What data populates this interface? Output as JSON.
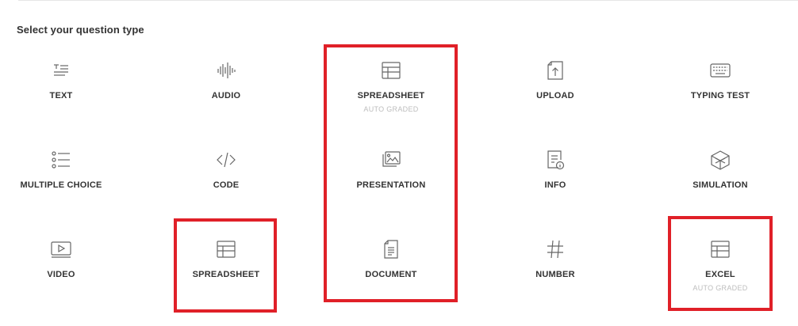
{
  "heading": "Select your question type",
  "tiles": {
    "text": {
      "label": "TEXT",
      "icon": "text-lines-icon"
    },
    "audio": {
      "label": "AUDIO",
      "icon": "waveform-icon"
    },
    "spreadsheet_auto": {
      "label": "SPREADSHEET",
      "sub": "AUTO GRADED",
      "icon": "spreadsheet-icon"
    },
    "upload": {
      "label": "UPLOAD",
      "icon": "file-upload-icon"
    },
    "typing_test": {
      "label": "TYPING TEST",
      "icon": "keyboard-icon"
    },
    "multiple_choice": {
      "label": "MULTIPLE CHOICE",
      "icon": "list-bullets-icon"
    },
    "code": {
      "label": "CODE",
      "icon": "code-brackets-icon"
    },
    "presentation": {
      "label": "PRESENTATION",
      "icon": "presentation-images-icon"
    },
    "info": {
      "label": "INFO",
      "icon": "info-document-icon"
    },
    "simulation": {
      "label": "SIMULATION",
      "icon": "cube-icon"
    },
    "video": {
      "label": "VIDEO",
      "icon": "video-player-icon"
    },
    "spreadsheet": {
      "label": "SPREADSHEET",
      "icon": "spreadsheet-icon"
    },
    "document": {
      "label": "DOCUMENT",
      "icon": "document-icon"
    },
    "number": {
      "label": "NUMBER",
      "icon": "hash-icon"
    },
    "excel": {
      "label": "EXCEL",
      "sub": "AUTO GRADED",
      "icon": "spreadsheet-icon"
    }
  },
  "colors": {
    "highlight": "#e02028",
    "icon": "#666666",
    "sub": "#bdbdbd"
  }
}
